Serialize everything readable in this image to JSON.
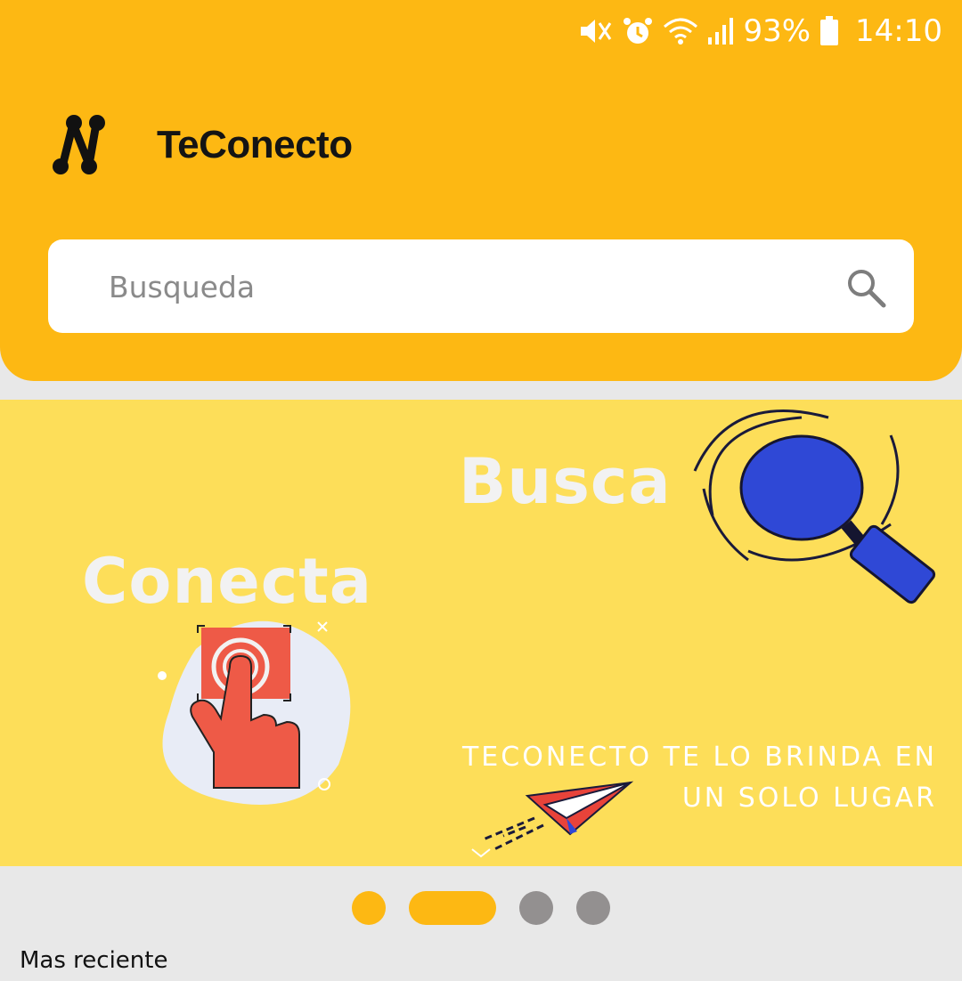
{
  "status_bar": {
    "battery": "93%",
    "time": "14:10",
    "icons": [
      "mute-icon",
      "alarm-icon",
      "wifi-icon",
      "signal-icon",
      "battery-icon"
    ]
  },
  "header": {
    "app_title": "TeConecto",
    "logo": "teconecto-logo-icon",
    "background_color": "#fdb813"
  },
  "search": {
    "placeholder": "Busqueda",
    "value": "",
    "icon": "search-icon"
  },
  "banner": {
    "word_1": "Busca",
    "word_2": "Conecta",
    "tagline_line_1": "TECONECTO TE LO BRINDA EN",
    "tagline_line_2": "UN SOLO LUGAR",
    "background_color": "#fdde59"
  },
  "carousel": {
    "page_count": 4,
    "current_page": 2
  },
  "section": {
    "title": "Mas reciente"
  }
}
